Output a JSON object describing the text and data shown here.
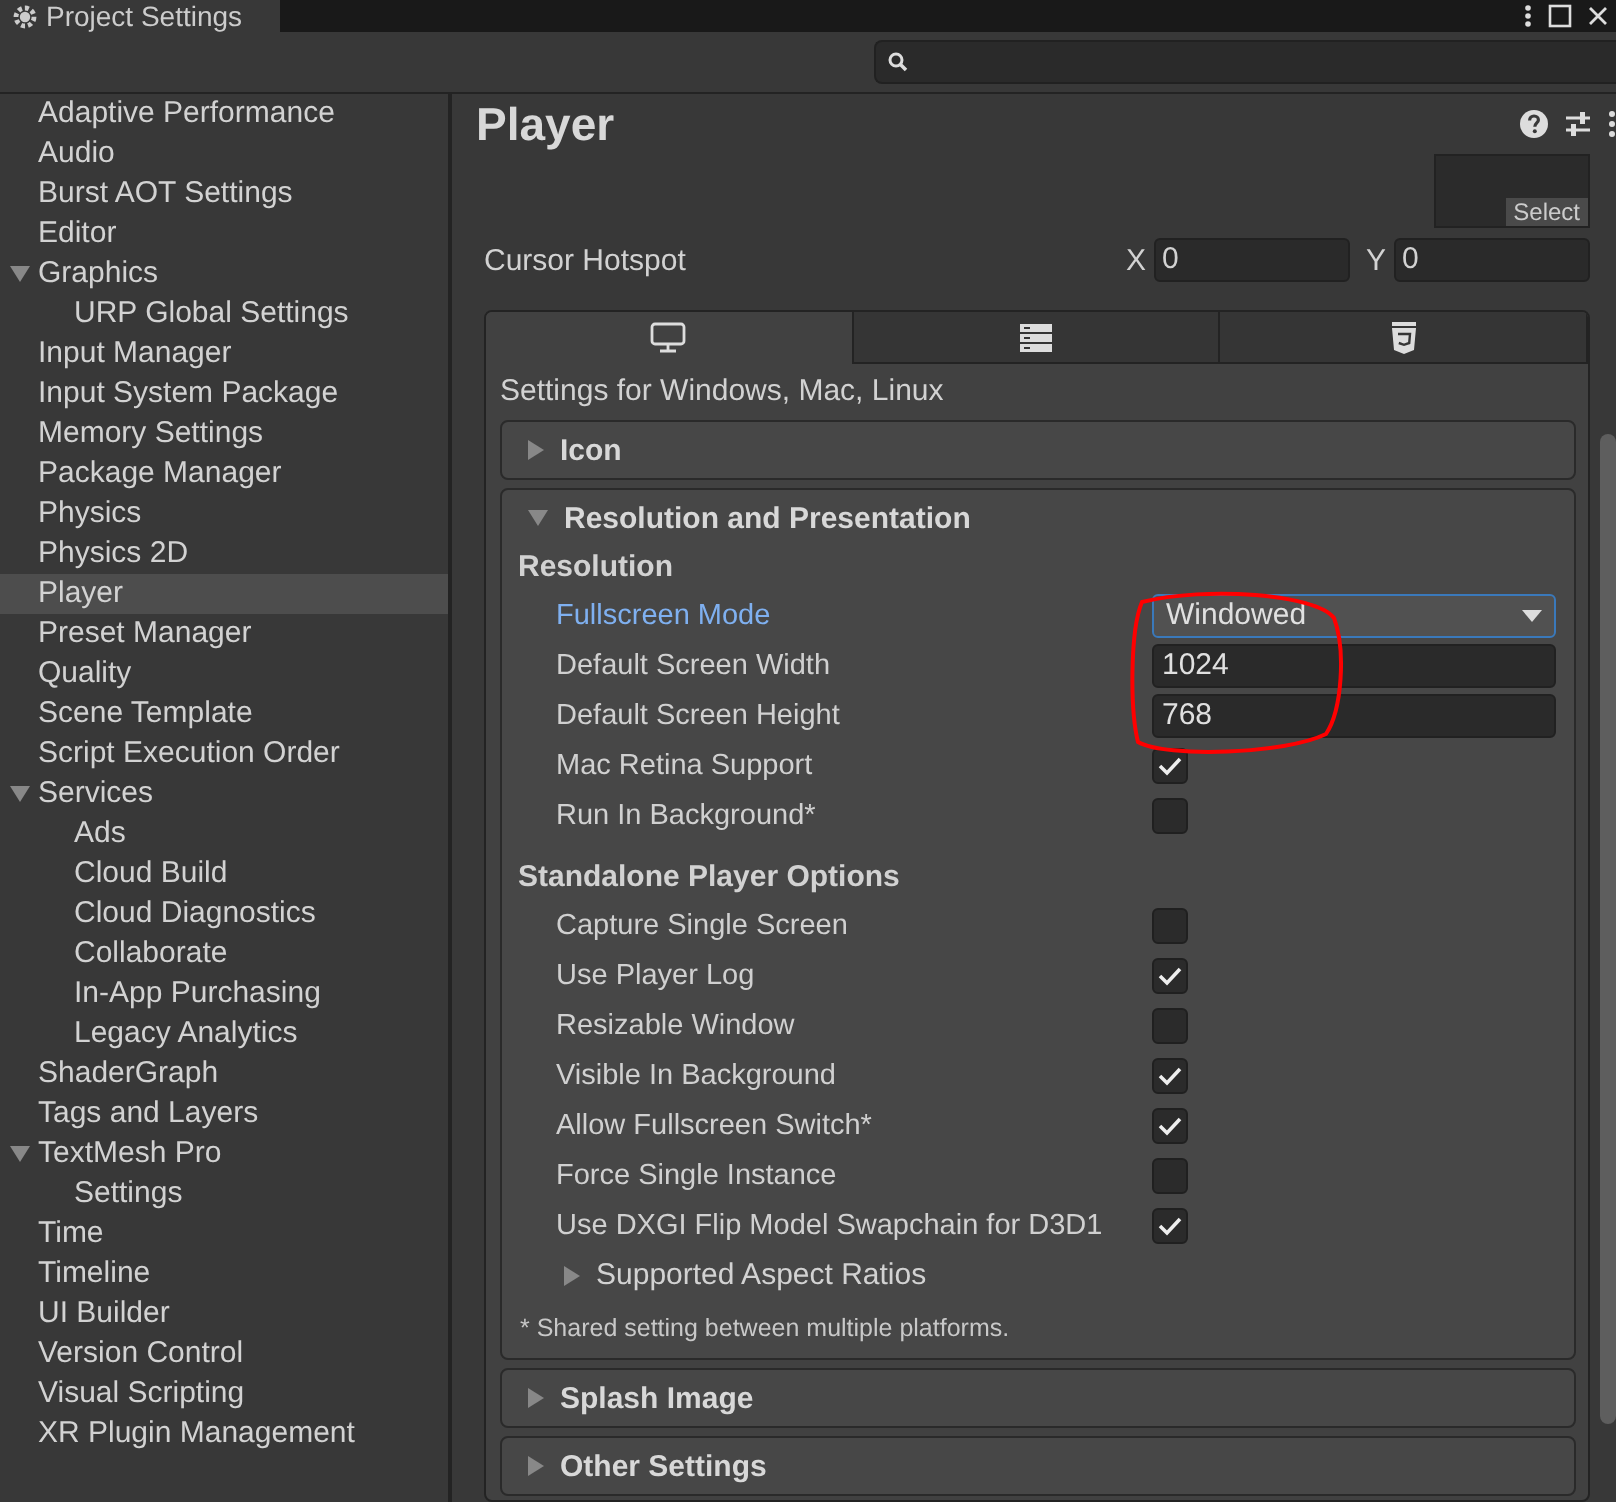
{
  "window": {
    "tab_title": "Project Settings"
  },
  "sidebar": {
    "items": [
      {
        "label": "Adaptive Performance",
        "selected": false
      },
      {
        "label": "Audio",
        "selected": false
      },
      {
        "label": "Burst AOT Settings",
        "selected": false
      },
      {
        "label": "Editor",
        "selected": false
      },
      {
        "label": "Graphics",
        "selected": false,
        "expanded": true,
        "children": [
          {
            "label": "URP Global Settings",
            "selected": false
          }
        ]
      },
      {
        "label": "Input Manager",
        "selected": false
      },
      {
        "label": "Input System Package",
        "selected": false
      },
      {
        "label": "Memory Settings",
        "selected": false
      },
      {
        "label": "Package Manager",
        "selected": false
      },
      {
        "label": "Physics",
        "selected": false
      },
      {
        "label": "Physics 2D",
        "selected": false
      },
      {
        "label": "Player",
        "selected": true
      },
      {
        "label": "Preset Manager",
        "selected": false
      },
      {
        "label": "Quality",
        "selected": false
      },
      {
        "label": "Scene Template",
        "selected": false
      },
      {
        "label": "Script Execution Order",
        "selected": false
      },
      {
        "label": "Services",
        "selected": false,
        "expanded": true,
        "children": [
          {
            "label": "Ads",
            "selected": false
          },
          {
            "label": "Cloud Build",
            "selected": false
          },
          {
            "label": "Cloud Diagnostics",
            "selected": false
          },
          {
            "label": "Collaborate",
            "selected": false
          },
          {
            "label": "In-App Purchasing",
            "selected": false
          },
          {
            "label": "Legacy Analytics",
            "selected": false
          }
        ]
      },
      {
        "label": "ShaderGraph",
        "selected": false
      },
      {
        "label": "Tags and Layers",
        "selected": false
      },
      {
        "label": "TextMesh Pro",
        "selected": false,
        "expanded": true,
        "children": [
          {
            "label": "Settings",
            "selected": false
          }
        ]
      },
      {
        "label": "Time",
        "selected": false
      },
      {
        "label": "Timeline",
        "selected": false
      },
      {
        "label": "UI Builder",
        "selected": false
      },
      {
        "label": "Version Control",
        "selected": false
      },
      {
        "label": "Visual Scripting",
        "selected": false
      },
      {
        "label": "XR Plugin Management",
        "selected": false
      }
    ]
  },
  "inspector": {
    "title": "Player",
    "icon_preview": {
      "button": "Select"
    },
    "cursor_hotspot": {
      "label": "Cursor Hotspot",
      "x_label": "X",
      "x_value": "0",
      "y_label": "Y",
      "y_value": "0"
    },
    "platform_tabs": [
      {
        "kind": "desktop",
        "selected": true
      },
      {
        "kind": "server",
        "selected": false
      },
      {
        "kind": "webgl",
        "selected": false
      }
    ],
    "platform_heading": "Settings for Windows, Mac, Linux",
    "sections": [
      {
        "title": "Icon",
        "expanded": false
      },
      {
        "title": "Resolution and Presentation",
        "expanded": true,
        "groups": [
          {
            "heading": "Resolution",
            "fields": [
              {
                "kind": "dropdown",
                "label": "Fullscreen Mode",
                "value": "Windowed",
                "focused": true
              },
              {
                "kind": "number",
                "label": "Default Screen Width",
                "value": "1024",
                "focused": false
              },
              {
                "kind": "number",
                "label": "Default Screen Height",
                "value": "768",
                "focused": false
              },
              {
                "kind": "checkbox",
                "label": "Mac Retina Support",
                "checked": true,
                "focused": false
              },
              {
                "kind": "checkbox",
                "label": "Run In Background*",
                "checked": false,
                "focused": false
              }
            ]
          },
          {
            "heading": "Standalone Player Options",
            "fields": [
              {
                "kind": "checkbox",
                "label": "Capture Single Screen",
                "checked": false,
                "focused": false
              },
              {
                "kind": "checkbox",
                "label": "Use Player Log",
                "checked": true,
                "focused": false
              },
              {
                "kind": "checkbox",
                "label": "Resizable Window",
                "checked": false,
                "focused": false
              },
              {
                "kind": "checkbox",
                "label": "Visible In Background",
                "checked": true,
                "focused": false
              },
              {
                "kind": "checkbox",
                "label": "Allow Fullscreen Switch*",
                "checked": true,
                "focused": false
              },
              {
                "kind": "checkbox",
                "label": "Force Single Instance",
                "checked": false,
                "focused": false
              },
              {
                "kind": "checkbox",
                "label": "Use DXGI Flip Model Swapchain for D3D1",
                "checked": true,
                "focused": false
              },
              {
                "kind": "foldout",
                "label": "Supported Aspect Ratios",
                "expanded": false
              }
            ]
          }
        ],
        "note": "* Shared setting between multiple platforms."
      },
      {
        "title": "Splash Image",
        "expanded": false
      },
      {
        "title": "Other Settings",
        "expanded": false
      }
    ]
  },
  "annotation": {
    "kind": "ellipse",
    "color": "#ff0000"
  }
}
